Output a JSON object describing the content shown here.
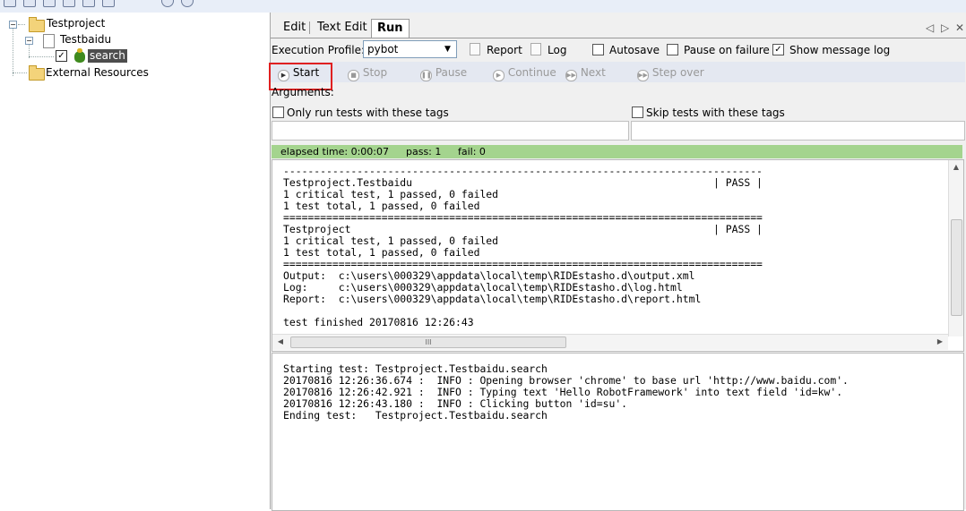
{
  "tree": {
    "items": [
      {
        "label": "Testproject",
        "icon": "folder-icon"
      },
      {
        "label": "Testbaidu",
        "icon": "file-icon"
      },
      {
        "label": "search",
        "icon": "bug-icon",
        "checked": true
      },
      {
        "label": "External Resources",
        "icon": "folder-icon"
      }
    ]
  },
  "tabs": [
    {
      "label": "Edit"
    },
    {
      "label": "Text Edit"
    },
    {
      "label": "Run",
      "active": true
    }
  ],
  "tab_nav": {
    "left": "◁",
    "right": "▷",
    "close": "✕"
  },
  "profile": {
    "label": "Execution Profile:",
    "value": "pybot",
    "report_label": "Report",
    "log_label": "Log",
    "autosave_label": "Autosave",
    "autosave_checked": false,
    "pause_label": "Pause on failure",
    "pause_checked": false,
    "show_log_label": "Show message log",
    "show_log_checked": true
  },
  "run_buttons": [
    {
      "label": "Start",
      "enabled": true
    },
    {
      "label": "Stop",
      "enabled": false
    },
    {
      "label": "Pause",
      "enabled": false
    },
    {
      "label": "Continue",
      "enabled": false
    },
    {
      "label": "Next",
      "enabled": false
    },
    {
      "label": "Step over",
      "enabled": false
    }
  ],
  "arguments": {
    "label": "Arguments:",
    "only_run_label": "Only run tests with these tags",
    "skip_label": "Skip tests with these tags"
  },
  "status": {
    "elapsed": "elapsed time: 0:00:07",
    "pass": "pass: 1",
    "fail": "fail: 0",
    "color": "#a4d48e"
  },
  "output_console": {
    "lines": [
      "------------------------------------------------------------------------------",
      "Testproject.Testbaidu                                                 | PASS |",
      "1 critical test, 1 passed, 0 failed",
      "1 test total, 1 passed, 0 failed",
      "==============================================================================",
      "Testproject                                                           | PASS |",
      "1 critical test, 1 passed, 0 failed",
      "1 test total, 1 passed, 0 failed",
      "==============================================================================",
      "Output:  c:\\users\\000329\\appdata\\local\\temp\\RIDEstasho.d\\output.xml",
      "Log:     c:\\users\\000329\\appdata\\local\\temp\\RIDEstasho.d\\log.html",
      "Report:  c:\\users\\000329\\appdata\\local\\temp\\RIDEstasho.d\\report.html",
      "",
      "test finished 20170816 12:26:43"
    ],
    "hscroll_grip": "III"
  },
  "message_log": {
    "lines": [
      "Starting test: Testproject.Testbaidu.search",
      "20170816 12:26:36.674 :  INFO : Opening browser 'chrome' to base url 'http://www.baidu.com'.",
      "20170816 12:26:42.921 :  INFO : Typing text 'Hello RobotFramework' into text field 'id=kw'.",
      "20170816 12:26:43.180 :  INFO : Clicking button 'id=su'.",
      "Ending test:   Testproject.Testbaidu.search"
    ]
  }
}
